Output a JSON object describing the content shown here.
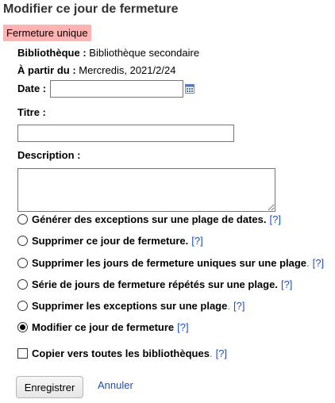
{
  "header": {
    "title": "Modifier ce jour de fermeture"
  },
  "badge": {
    "label": "Fermeture unique"
  },
  "info": {
    "library_label": "Bibliothèque :",
    "library_value": "Bibliothèque secondaire",
    "from_label": "À partir du :",
    "from_value": "Mercredis, 2021/2/24"
  },
  "form": {
    "date_label": "Date :",
    "date_value": "",
    "title_label": "Titre :",
    "title_value": "",
    "description_label": "Description :",
    "description_value": ""
  },
  "options": [
    {
      "label": "Générer des exceptions sur une plage de dates.",
      "suffix": "",
      "help": "[?]",
      "checked": false
    },
    {
      "label": "Supprimer ce jour de fermeture.",
      "suffix": "",
      "help": "[?]",
      "checked": false
    },
    {
      "label": "Supprimer les jours de fermeture uniques sur une plage",
      "suffix": ".",
      "help": "[?]",
      "checked": false
    },
    {
      "label": "Série de jours de fermeture répétés sur une plage.",
      "suffix": "",
      "help": "[?]",
      "checked": false
    },
    {
      "label": "Supprimer les exceptions sur une plage",
      "suffix": ".",
      "help": "[?]",
      "checked": false
    },
    {
      "label": "Modifier ce jour de fermeture",
      "suffix": "",
      "help": "[?]",
      "checked": true
    }
  ],
  "copy_all": {
    "label": "Copier vers toutes les bibliothèques",
    "suffix": ".",
    "help": "[?]",
    "checked": false
  },
  "actions": {
    "save_label": "Enregistrer",
    "cancel_label": "Annuler"
  },
  "colors": {
    "badge_bg": "#ffb3b3",
    "link": "#1d4fb8",
    "title": "#333333"
  },
  "icons": {
    "calendar": "calendar-icon"
  }
}
